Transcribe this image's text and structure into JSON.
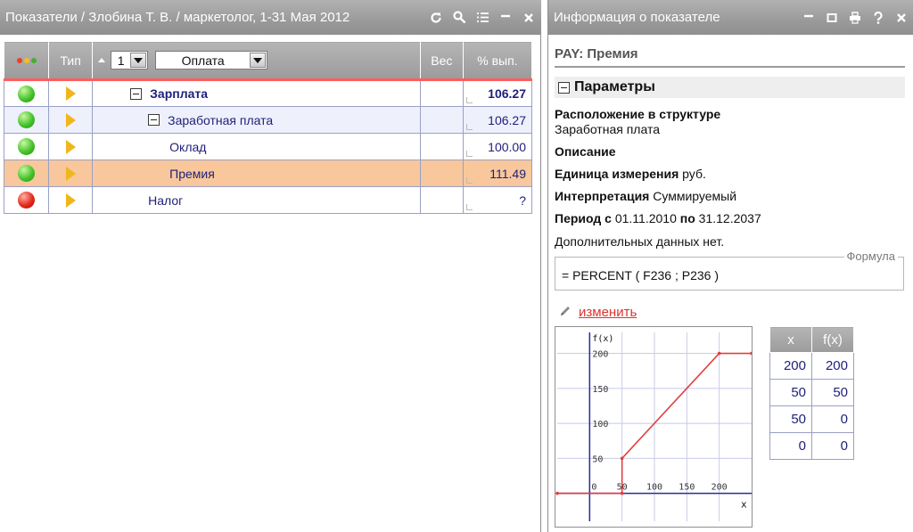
{
  "left_panel": {
    "title": "Показатели / Злобина Т. В. / маркетолог, 1-31 Мая 2012",
    "columns": {
      "type": "Тип",
      "weight": "Вес",
      "percent": "% вып."
    },
    "level_value": "1",
    "group_value": "Оплата",
    "rows": [
      {
        "status": "green",
        "name": "Зарплата",
        "level": 0,
        "bold": true,
        "expandable": true,
        "percent": "106.27",
        "percent_bold": true
      },
      {
        "status": "green",
        "name": "Заработная плата",
        "level": 1,
        "bold": false,
        "expandable": true,
        "percent": "106.27",
        "percent_bold": false
      },
      {
        "status": "green",
        "name": "Оклад",
        "level": 2,
        "bold": false,
        "expandable": false,
        "percent": "100.00",
        "percent_bold": false
      },
      {
        "status": "green",
        "name": "Премия",
        "level": 2,
        "bold": false,
        "expandable": false,
        "percent": "111.49",
        "percent_bold": false,
        "selected": true
      },
      {
        "status": "red",
        "name": "Налог",
        "level": 1,
        "bold": false,
        "expandable": false,
        "percent": "?",
        "percent_bold": false
      }
    ]
  },
  "right_panel": {
    "title": "Информация о показателе",
    "indicator_code": "PAY: Премия",
    "section_title": "Параметры",
    "location_label": "Расположение в структуре",
    "location_value": "Заработная плата",
    "description_label": "Описание",
    "unit_label": "Единица измерения",
    "unit_value": "руб.",
    "interpretation_label": "Интерпретация",
    "interpretation_value": "Суммируемый",
    "period_label": "Период с",
    "period_from": "01.11.2010",
    "period_to_label": "по",
    "period_to": "31.12.2037",
    "no_data_text": "Дополнительных данных нет.",
    "formula_legend": "Формула",
    "formula": "= PERCENT ( F236 ; P236 )",
    "edit_label": "изменить",
    "table": {
      "headers": [
        "x",
        "f(x)"
      ],
      "rows": [
        [
          "200",
          "200"
        ],
        [
          "50",
          "50"
        ],
        [
          "50",
          "0"
        ],
        [
          "0",
          "0"
        ]
      ]
    }
  },
  "colors": {
    "titlebar": "#9f9f9f",
    "accent_red": "#ff5c5c",
    "selected_row": "#f8c79b",
    "link": "#e03030",
    "grid_text": "#1f1f7a"
  },
  "chart_data": {
    "type": "line",
    "ylabel": "f(x)",
    "xlabel": "x",
    "xlim": [
      -50,
      250
    ],
    "ylim": [
      -40,
      230
    ],
    "x_ticks": [
      0,
      50,
      100,
      150,
      200
    ],
    "y_ticks": [
      50,
      100,
      150,
      200
    ],
    "grid": true,
    "series": [
      {
        "x": [
          -50,
          50,
          50,
          200,
          250
        ],
        "y": [
          0,
          0,
          50,
          200,
          200
        ],
        "color": "#e04040"
      }
    ]
  }
}
